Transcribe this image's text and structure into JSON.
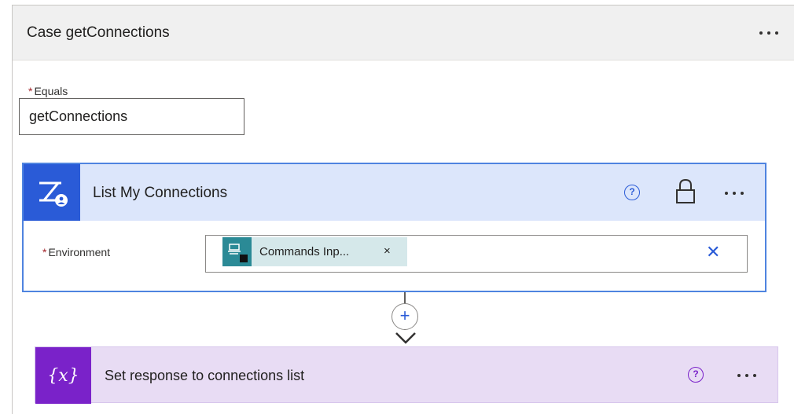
{
  "case": {
    "title": "Case getConnections",
    "equals_label": "Equals",
    "required_marker": "*",
    "equals_value": "getConnections"
  },
  "list_action": {
    "title": "List My Connections",
    "help_glyph": "?",
    "environment_label": "Environment",
    "environment_token": "Commands Inp...",
    "token_remove_glyph": "×",
    "clear_glyph": "✕"
  },
  "connector": {
    "add_glyph": "+"
  },
  "var_action": {
    "icon_text": "{x}",
    "title": "Set response to connections list",
    "help_glyph": "?"
  },
  "colors": {
    "action_blue": "#2a5bd7",
    "action_header": "#dce6fb",
    "variable_purple": "#7a22c9",
    "variable_header": "#e8dcf4",
    "token_teal": "#2b8a96"
  },
  "icons": [
    "more-options-icon",
    "list-connections-icon",
    "help-icon",
    "lock-icon",
    "environment-icon",
    "close-icon",
    "add-icon",
    "arrow-down-icon",
    "variable-icon"
  ]
}
